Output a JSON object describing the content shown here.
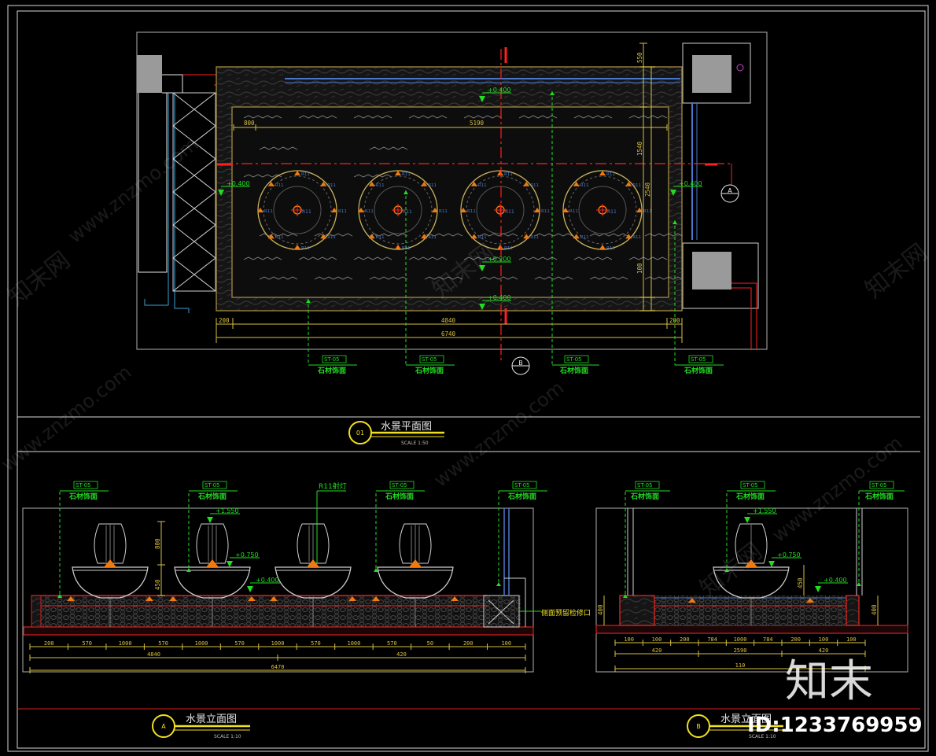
{
  "colors": {
    "frame": "#d8d8d8",
    "wall": "#9a8240",
    "gold": "#c8b25a",
    "green": "#22dd22",
    "red": "#ff2020",
    "blue": "#4a78c8",
    "cyan": "#3aa0d8",
    "yellow": "#f0e020",
    "orange": "#f07a10",
    "white": "#e8e8e8",
    "grey": "#a0a0a0",
    "stone": "#4a4a4a",
    "purple": "#cc44cc"
  },
  "plan": {
    "dims_top": [
      "800",
      "5190"
    ],
    "dims_bottom": [
      "200",
      "4840",
      "200",
      "6740"
    ],
    "dims_right": [
      "550",
      "1540",
      "2540",
      "100"
    ],
    "levels": [
      "+0.400",
      "+0.400",
      "+0.400",
      "+0.200",
      "+0.400"
    ],
    "lamp_code": "R11",
    "material_code": "ST-05",
    "material_label": "石材饰面",
    "section_a": "A",
    "section_b": "B"
  },
  "titles": {
    "plan_no": "01",
    "plan_title": "水景平面图",
    "plan_scale": "SCALE 1:50",
    "elev_no": "A",
    "elev_title": "水景立面图",
    "elev_scale": "SCALE 1:10",
    "side_no": "B",
    "side_title": "水景立面图",
    "side_scale": "SCALE 1:10"
  },
  "elevation": {
    "lamp_label": "R11射灯",
    "outlet_label": "侧面预留检修口",
    "levels": [
      "+1.550",
      "+0.750",
      "+0.400"
    ],
    "dims_v": [
      "800",
      "450"
    ],
    "dims_row1": [
      "200",
      "570",
      "1000",
      "570",
      "1000",
      "570",
      "1000",
      "570",
      "1000",
      "570",
      "50",
      "200",
      "100"
    ],
    "dims_row2": [
      "4840",
      "420"
    ],
    "dims_total": "6470"
  },
  "side": {
    "levels": [
      "+1.550",
      "+0.750",
      "+0.400"
    ],
    "dims_v": [
      "400",
      "450",
      "400"
    ],
    "dims_row1": [
      "100",
      "100",
      "200",
      "784",
      "1000",
      "784",
      "200",
      "100",
      "100"
    ],
    "dims_row2": [
      "420",
      "2590",
      "420"
    ],
    "dims_total": "110"
  },
  "watermark": {
    "site": "www.znzmo.com",
    "brand": "知末网",
    "logo": "知末",
    "id": "ID:1233769959"
  }
}
